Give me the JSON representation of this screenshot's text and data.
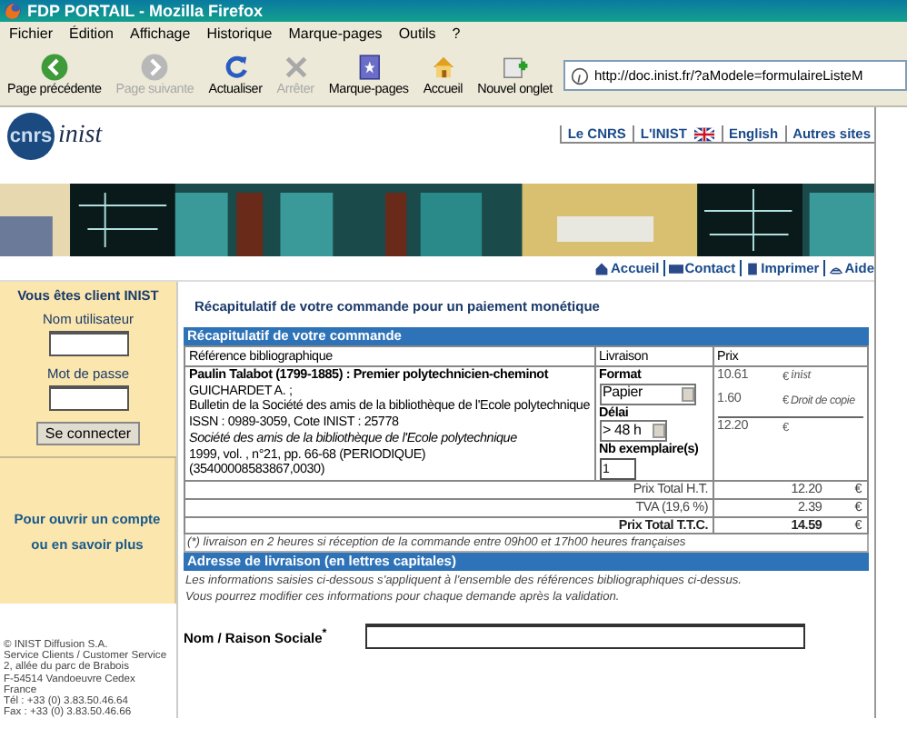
{
  "window": {
    "title": "FDP PORTAIL - Mozilla Firefox"
  },
  "menu": [
    "Fichier",
    "Édition",
    "Affichage",
    "Historique",
    "Marque-pages",
    "Outils",
    "?"
  ],
  "toolbar": [
    {
      "kind": "back",
      "label": "Page précédente",
      "disabled": false
    },
    {
      "kind": "forward",
      "label": "Page suivante",
      "disabled": true
    },
    {
      "kind": "reload",
      "label": "Actualiser",
      "disabled": false
    },
    {
      "kind": "stop",
      "label": "Arrêter",
      "disabled": true
    },
    {
      "kind": "bookmarks",
      "label": "Marque-pages",
      "disabled": false
    },
    {
      "kind": "home",
      "label": "Accueil",
      "disabled": false
    },
    {
      "kind": "newtab",
      "label": "Nouvel onglet",
      "disabled": false
    }
  ],
  "address": "http://doc.inist.fr/?aModele=formulaireListeM",
  "logo": {
    "badge": "cnrs",
    "name": "inist"
  },
  "header_links": [
    {
      "label": "Le CNRS",
      "flag": false
    },
    {
      "label": "L'INIST",
      "flag": false
    },
    {
      "label": "English",
      "flag": true
    },
    {
      "label": "Autres sites",
      "flag": false
    }
  ],
  "sub_links": [
    {
      "kind": "home",
      "label": "Accueil"
    },
    {
      "kind": "mail",
      "label": "Contact"
    },
    {
      "kind": "print",
      "label": "Imprimer"
    },
    {
      "kind": "help",
      "label": "Aide"
    }
  ],
  "sidebar": {
    "title": "Vous êtes client INIST",
    "user_label": "Nom utilisateur",
    "password_label": "Mot de passe",
    "button": "Se connecter",
    "account_link": [
      "Pour ouvrir un compte",
      "ou en savoir plus"
    ],
    "footer": [
      "© INIST Diffusion S.A.",
      "Service Clients / Customer Service",
      "2, allée du parc de Brabois",
      "F-54514 Vandoeuvre Cedex",
      "France",
      "Tél : +33 (0) 3.83.50.46.64",
      "Fax : +33 (0) 3.83.50.46.66"
    ]
  },
  "heading": "Récapitulatif de votre commande pour un paiement monétique",
  "order": {
    "title": "Récapitulatif de votre commande",
    "columns": [
      "Référence bibliographique",
      "Livraison",
      "Prix"
    ],
    "item": {
      "title": "Paulin Talabot (1799-1885) : Premier polytechnicien-cheminot",
      "author": "GUICHARDET A. ;",
      "journal": "Bulletin de la Société des amis de la bibliothèque de l'Ecole polytechnique",
      "issn": "ISSN : 0989-3059, Cote INIST : 25778",
      "publisher": "Société des amis de la bibliothèque de l'Ecole polytechnique",
      "details": "1999, vol. , n°21, pp. 66-68 (PERIODIQUE)",
      "ref": "(35400008583867,0030)",
      "format_label": "Format",
      "format": "Papier",
      "delay_label": "Délai",
      "delay": "> 48 h",
      "qty_label": "Nb exemplaire(s)",
      "qty": "1",
      "prices": [
        {
          "amount": "10.61",
          "currency": "€",
          "note": "inist",
          "kind": "logo"
        },
        {
          "amount": "1.60",
          "currency": "€",
          "note": "Droit de copie",
          "kind": "text"
        },
        {
          "amount": "12.20",
          "currency": "€",
          "kind": "total"
        }
      ]
    },
    "totals": [
      {
        "label": "Prix Total H.T.",
        "amount": "12.20",
        "currency": "€",
        "emphasis": false
      },
      {
        "label": "TVA (19,6 %)",
        "amount": "2.39",
        "currency": "€",
        "emphasis": false
      },
      {
        "label": "Prix Total T.T.C.",
        "amount": "14.59",
        "currency": "€",
        "emphasis": true
      }
    ],
    "note": "(*) livraison en 2 heures si réception de la commande entre 09h00 et 17h00 heures françaises"
  },
  "address_section": {
    "title": "Adresse de livraison (en lettres capitales)",
    "info": [
      "Les informations saisies ci-dessous s'appliquent à l'ensemble des références bibliographiques ci-dessus.",
      "Vous pourrez modifier ces informations pour chaque demande après la validation."
    ],
    "fields": [
      {
        "label": "Nom / Raison Sociale",
        "required": true,
        "mark": "*"
      }
    ]
  }
}
